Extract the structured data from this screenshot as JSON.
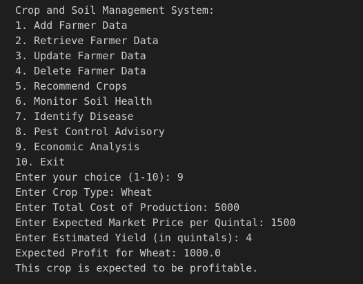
{
  "colors": {
    "background": "#1e1e1e",
    "text": "#cccccc"
  },
  "terminal": {
    "lines": [
      "Crop and Soil Management System:",
      "1. Add Farmer Data",
      "2. Retrieve Farmer Data",
      "3. Update Farmer Data",
      "4. Delete Farmer Data",
      "5. Recommend Crops",
      "6. Monitor Soil Health",
      "7. Identify Disease",
      "8. Pest Control Advisory",
      "9. Economic Analysis",
      "10. Exit",
      "Enter your choice (1-10): 9",
      "Enter Crop Type: Wheat",
      "Enter Total Cost of Production: 5000",
      "Enter Expected Market Price per Quintal: 1500",
      "Enter Estimated Yield (in quintals): 4",
      "Expected Profit for Wheat: 1000.0",
      "This crop is expected to be profitable."
    ]
  }
}
